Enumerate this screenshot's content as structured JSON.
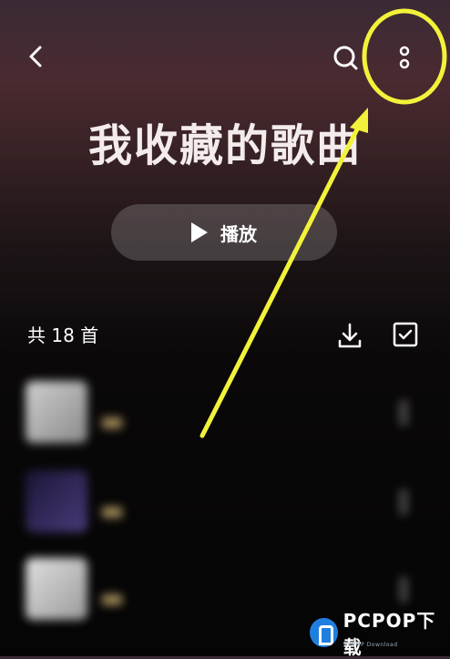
{
  "header": {
    "back_icon": "chevron-left-icon",
    "search_icon": "search-icon",
    "more_icon": "more-vertical-icon"
  },
  "playlist": {
    "title": "我收藏的歌曲",
    "play_label": "播放",
    "count_label": "共 18 首"
  },
  "toolbar": {
    "download_icon": "download-icon",
    "select_icon": "checkbox-icon"
  },
  "songs": [
    {
      "title": "",
      "subtitle": ""
    },
    {
      "title": "",
      "subtitle": ""
    },
    {
      "title": "",
      "subtitle": ""
    }
  ],
  "watermark": {
    "brand": "PCPOP下载",
    "sub": "PCPOP Download"
  },
  "colors": {
    "annotation": "#f2f23a",
    "accent": "#1f7fe0"
  }
}
